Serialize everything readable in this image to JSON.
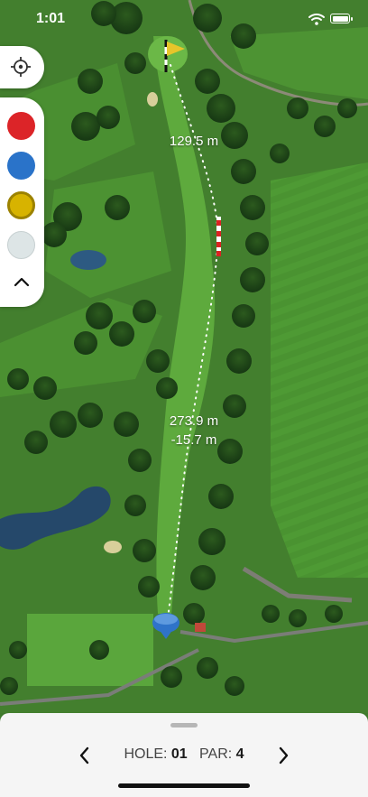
{
  "status_bar": {
    "time": "1:01"
  },
  "map": {
    "distance_top": "129.5 m",
    "distance_bottom": "273.9 m",
    "elevation_bottom": "-15.7 m"
  },
  "markers": {
    "colors": [
      "#dc2428",
      "#2a73c9",
      "#d7b300",
      "#dde5e6"
    ]
  },
  "hole_bar": {
    "hole_label": "HOLE:",
    "hole_number": "01",
    "par_label": "PAR:",
    "par_number": "4"
  }
}
